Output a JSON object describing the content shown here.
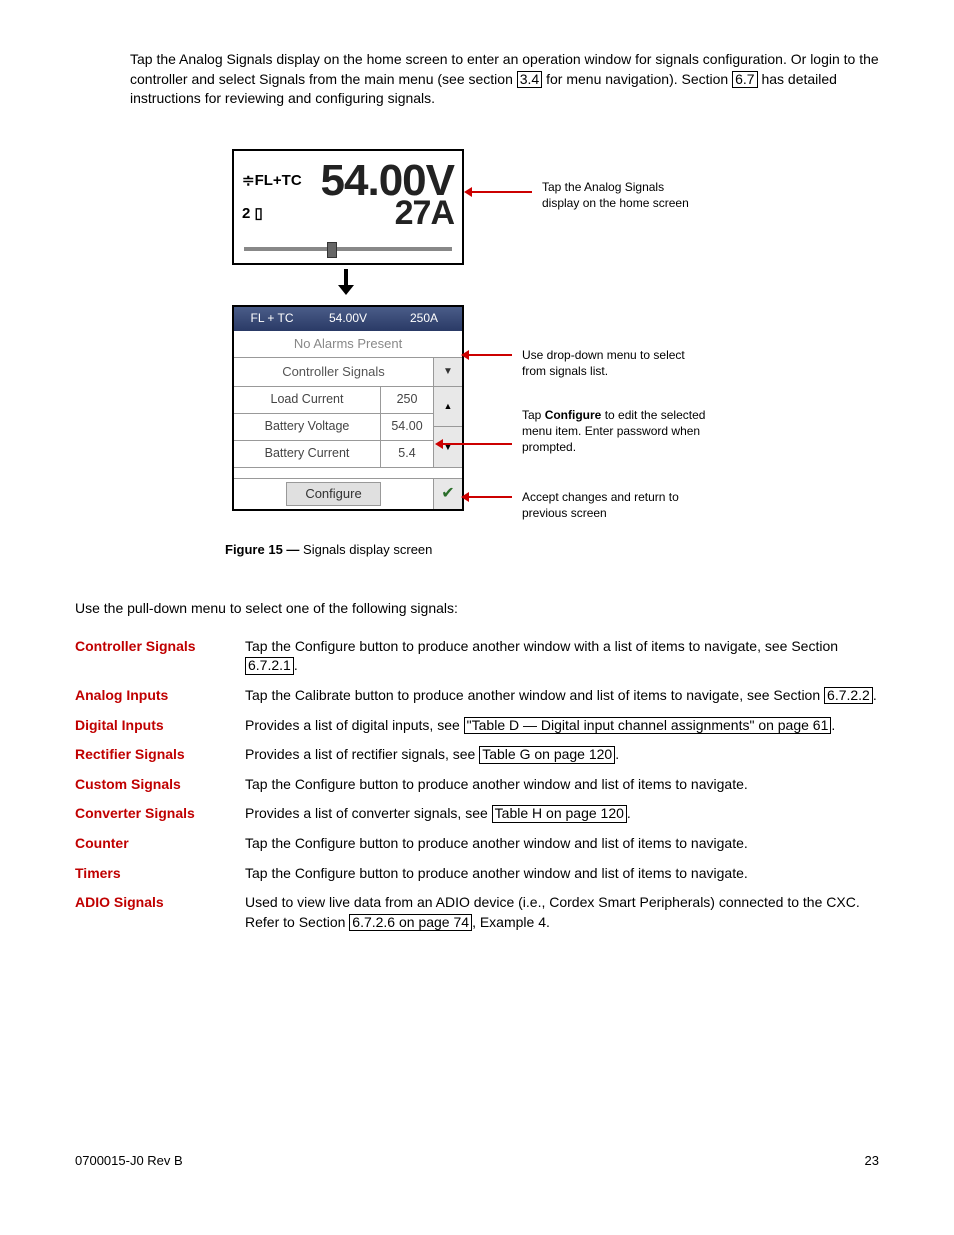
{
  "intro": {
    "p1a": "Tap the Analog Signals display on the home screen to enter an operation window for signals configuration. Or login to the controller and select Signals from the main menu (see section ",
    "ref1": "3.4",
    "p1b": " for menu navigation). Section ",
    "ref2": "6.7",
    "p1c": " has detailed instructions for reviewing and configuring signals."
  },
  "home_screen": {
    "mode": "FL+TC",
    "count": "2",
    "voltage": "54.00V",
    "current": "27A"
  },
  "signals_screen": {
    "top_left": "FL + TC",
    "top_mid": "54.00V",
    "top_right": "250A",
    "no_alarm": "No Alarms Present",
    "dropdown_label": "Controller Signals",
    "rows": [
      {
        "label": "Load Current",
        "value": "250"
      },
      {
        "label": "Battery Voltage",
        "value": "54.00"
      },
      {
        "label": "Battery Current",
        "value": "5.4"
      }
    ],
    "configure": "Configure"
  },
  "annotations": {
    "a1": "Tap the Analog Signals display on the home screen",
    "a2": "Use drop-down menu to select from signals list.",
    "a3a": "Tap ",
    "a3b": "Configure",
    "a3c": " to edit the selected menu item. Enter password when prompted.",
    "a4": "Accept changes and return to previous screen"
  },
  "figure": {
    "label": "Figure 15  —",
    "caption": "  Signals display screen"
  },
  "pulldown_intro": "Use the pull-down menu to select one of the following signals:",
  "defs": {
    "controller": {
      "term": "Controller Signals",
      "d1": "Tap the Configure button to produce another window with a list of items to navigate, see Section",
      "ref": "6.7.2.1",
      "d2": "."
    },
    "analog": {
      "term": "Analog Inputs",
      "d1": "Tap the Calibrate button to produce another window and list of items to navigate, see Section ",
      "ref": "6.7.2.2",
      "d2": "."
    },
    "digital": {
      "term": "Digital Inputs",
      "d1": "Provides a list of digital inputs, see ",
      "ref": "\"Table D  —  Digital input channel assignments\" on page 61",
      "d2": "."
    },
    "rectifier": {
      "term": "Rectifier Signals",
      "d1": "Provides a list of rectifier signals, see ",
      "ref": "Table G on page 120",
      "d2": "."
    },
    "custom": {
      "term": "Custom Signals",
      "d": "Tap the Configure button to produce another window and list of items to navigate."
    },
    "converter": {
      "term": "Converter Signals",
      "d1": "Provides a list of converter signals, see ",
      "ref": "Table H on page 120",
      "d2": "."
    },
    "counter": {
      "term": "Counter",
      "d": "Tap the Configure button to produce another window and list of items to navigate."
    },
    "timers": {
      "term": "Timers",
      "d": "Tap the Configure button to produce another window and list of items to navigate."
    },
    "adio": {
      "term": "ADIO Signals",
      "d1": "Used to view live data from an ADIO device (i.e., Cordex Smart Peripherals) connected to the CXC. Refer to Section ",
      "ref": "6.7.2.6 on page 74",
      "d2": ", Example 4."
    }
  },
  "footer": {
    "left": "0700015-J0    Rev B",
    "right": "23"
  }
}
